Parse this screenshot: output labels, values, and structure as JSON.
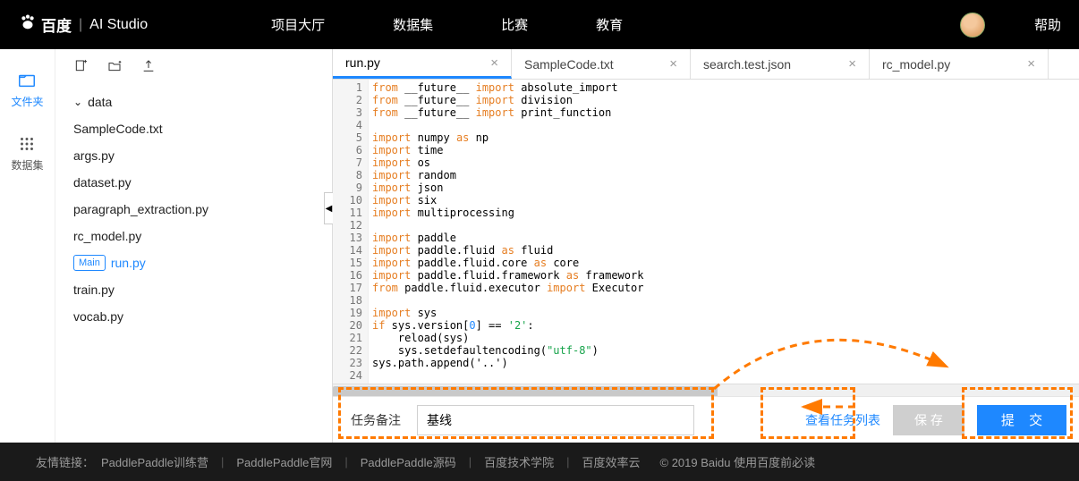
{
  "brand": {
    "baidu": "百度",
    "studio": "AI Studio"
  },
  "nav": {
    "lobby": "项目大厅",
    "datasets": "数据集",
    "contest": "比赛",
    "edu": "教育",
    "help": "帮助"
  },
  "rail": {
    "files": "文件夹",
    "datasets": "数据集"
  },
  "filetree": {
    "folder": "data",
    "files": {
      "sample": "SampleCode.txt",
      "args": "args.py",
      "dataset": "dataset.py",
      "para": "paragraph_extraction.py",
      "rc": "rc_model.py",
      "run": "run.py",
      "train": "train.py",
      "vocab": "vocab.py"
    },
    "main_tag": "Main"
  },
  "tabs": {
    "run": "run.py",
    "sample": "SampleCode.txt",
    "search": "search.test.json",
    "rc": "rc_model.py"
  },
  "code": {
    "l1": [
      "from",
      " __future__ ",
      "import",
      " absolute_import"
    ],
    "l2": [
      "from",
      " __future__ ",
      "import",
      " division"
    ],
    "l3": [
      "from",
      " __future__ ",
      "import",
      " print_function"
    ],
    "l5a": "import",
    "l5b": " numpy ",
    "l5c": "as",
    "l5d": " np",
    "l6a": "import",
    "l6b": " time",
    "l7a": "import",
    "l7b": " os",
    "l8a": "import",
    "l8b": " random",
    "l9a": "import",
    "l9b": " json",
    "l10a": "import",
    "l10b": " six",
    "l11a": "import",
    "l11b": " multiprocessing",
    "l13a": "import",
    "l13b": " paddle",
    "l14a": "import",
    "l14b": " paddle.fluid ",
    "l14c": "as",
    "l14d": " fluid",
    "l15a": "import",
    "l15b": " paddle.fluid.core ",
    "l15c": "as",
    "l15d": " core",
    "l16a": "import",
    "l16b": " paddle.fluid.framework ",
    "l16c": "as",
    "l16d": " framework",
    "l17a": "from",
    "l17b": " paddle.fluid.executor ",
    "l17c": "import",
    "l17d": " Executor",
    "l19a": "import",
    "l19b": " sys",
    "l20a": "if",
    "l20b": " sys.version[",
    "l20c": "0",
    "l20d": "] == ",
    "l20e": "'2'",
    "l20f": ":",
    "l21": "    reload(sys)",
    "l22a": "    sys.setdefaultencoding(",
    "l22b": "\"utf-8\"",
    "l22c": ")",
    "l23": "sys.path.append('..')"
  },
  "action": {
    "task_label": "任务备注",
    "task_value": "基线",
    "view_tasks": "查看任务列表",
    "save": "保 存",
    "submit": "提 交"
  },
  "footer": {
    "prefix": "友情链接：",
    "l1": "PaddlePaddle训练营",
    "l2": "PaddlePaddle官网",
    "l3": "PaddlePaddle源码",
    "l4": "百度技术学院",
    "l5": "百度效率云",
    "copy": "© 2019 Baidu 使用百度前必读"
  }
}
